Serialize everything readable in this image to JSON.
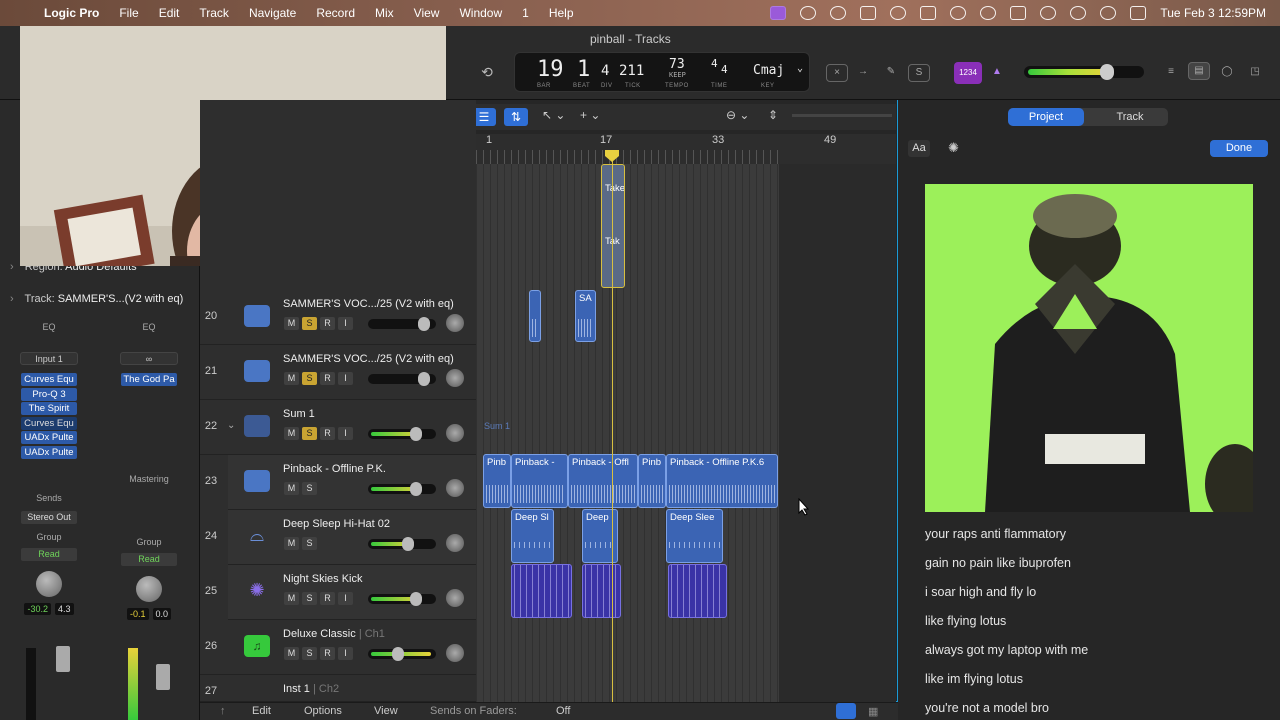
{
  "menubar": {
    "app": "Logic Pro",
    "items": [
      "File",
      "Edit",
      "Track",
      "Navigate",
      "Record",
      "Mix",
      "View",
      "Window",
      "1",
      "Help"
    ],
    "datetime": "Tue Feb 3  12:59PM"
  },
  "window": {
    "title": "pinball - Tracks"
  },
  "lcd": {
    "bar": "19",
    "beat": "1",
    "div": "4",
    "tick": "211",
    "tempo": "73",
    "tempo_sub": "KEEP",
    "sig_top": "4",
    "sig_bottom": "4",
    "key": "Cmaj",
    "labels": {
      "bar": "BAR",
      "beat": "BEAT",
      "div": "DIV",
      "tick": "TICK",
      "tempo": "TEMPO",
      "time": "TIME",
      "key": "KEY"
    }
  },
  "toolbar": {
    "count_badge": "1234"
  },
  "inspector": {
    "region_label": "Region:",
    "region_value": "Audio Defaults",
    "track_label": "Track:",
    "track_value": "SAMMER'S...(V2 with eq)",
    "strip1": {
      "eq": "EQ",
      "input": "Input 1",
      "plugins": [
        "Curves Equ",
        "Pro-Q 3",
        "The Spirit",
        "Curves Equ",
        "UADx Pulte",
        "UADx Pulte"
      ],
      "sends": "Sends",
      "output": "Stereo Out",
      "group": "Group",
      "automation": "Read",
      "db1": "-30.2",
      "db2": "4.3"
    },
    "strip2": {
      "eq": "EQ",
      "plugins": [
        "The God Pa"
      ],
      "output": "Mastering",
      "group": "Group",
      "automation": "Read",
      "db1": "-0.1",
      "db2": "0.0"
    }
  },
  "tracks": [
    {
      "num": "20",
      "name": "SAMMER'S VOC.../25 (V2 with eq)",
      "sub": "",
      "buttons": [
        "M",
        "S",
        "R",
        "I"
      ]
    },
    {
      "num": "21",
      "name": "SAMMER'S VOC.../25 (V2 with eq)",
      "sub": "",
      "buttons": [
        "M",
        "S",
        "R",
        "I"
      ]
    },
    {
      "num": "22",
      "name": "Sum 1",
      "sub": "",
      "buttons": [
        "M",
        "S",
        "R",
        "I"
      ]
    },
    {
      "num": "23",
      "name": "Pinback - Offline P.K.",
      "sub": "",
      "buttons": [
        "M",
        "S"
      ]
    },
    {
      "num": "24",
      "name": "Deep Sleep Hi-Hat 02",
      "sub": "",
      "buttons": [
        "M",
        "S"
      ]
    },
    {
      "num": "25",
      "name": "Night Skies Kick",
      "sub": "",
      "buttons": [
        "M",
        "S",
        "R",
        "I"
      ]
    },
    {
      "num": "26",
      "name": "Deluxe Classic",
      "sub": "| Ch1",
      "buttons": [
        "M",
        "S",
        "R",
        "I"
      ]
    },
    {
      "num": "27",
      "name": "Inst 1",
      "sub": "| Ch2",
      "buttons": []
    }
  ],
  "ruler": {
    "bars": [
      "1",
      "17",
      "33",
      "49"
    ]
  },
  "regions": {
    "take1": "Take",
    "take2": "Tak",
    "sa": "SA",
    "sum": "Sum 1",
    "pinback": [
      "Pinb",
      "Pinback -",
      "Pinback - Offl",
      "Pinb",
      "Pinback - Offline P.K.6"
    ],
    "deep": [
      "Deep Sl",
      "Deep",
      "Deep Slee"
    ]
  },
  "right_panel": {
    "tabs": [
      "Project",
      "Track"
    ],
    "aa": "Aa",
    "done": "Done",
    "lyrics": [
      "your raps anti flammatory",
      "gain no pain like ibuprofen",
      "i soar high and fly lo",
      "like flying lotus",
      "always got my laptop with me",
      "like im flying lotus",
      "you're not a model bro"
    ]
  },
  "bottombar": {
    "edit": "Edit",
    "options": "Options",
    "view": "View",
    "sends_label": "Sends on Faders:",
    "sends_value": "Off"
  },
  "colors": {
    "accent": "#2f6fd6",
    "solo": "#c9a432",
    "audio_region": "#3b64b4",
    "midi_region": "#3a33a6",
    "art_bg": "#9cf05a"
  }
}
